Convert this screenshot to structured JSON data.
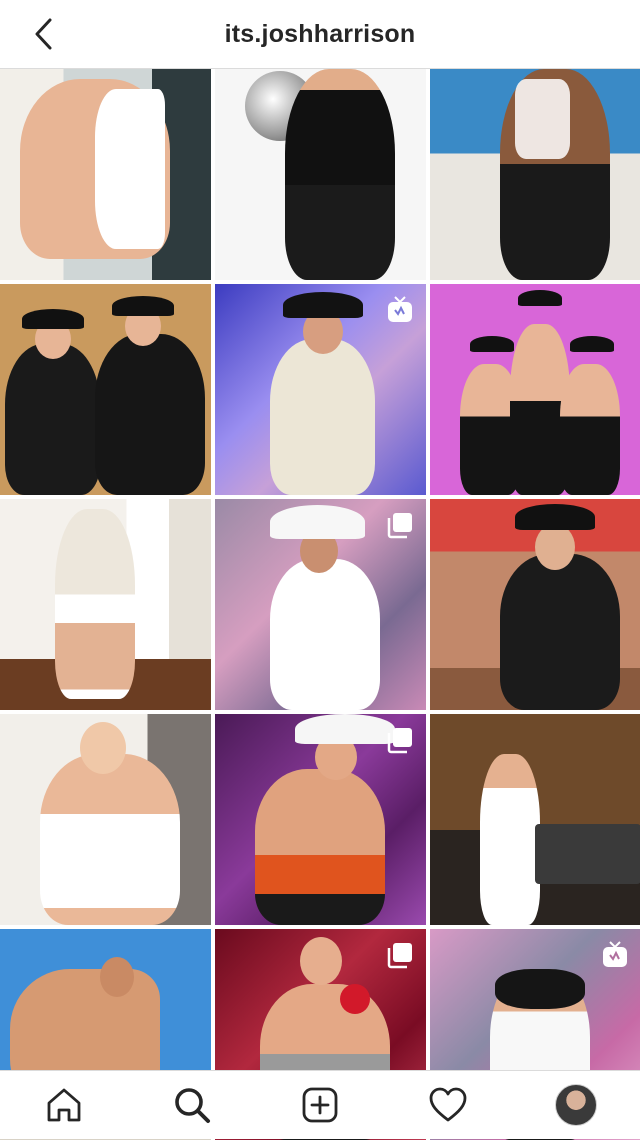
{
  "header": {
    "title": "its.joshharrison",
    "back_icon": "chevron-left-icon"
  },
  "grid": {
    "tiles": [
      {
        "name": "post-1",
        "badge": null
      },
      {
        "name": "post-2",
        "badge": null
      },
      {
        "name": "post-3",
        "badge": null
      },
      {
        "name": "post-4",
        "badge": null
      },
      {
        "name": "post-5",
        "badge": "igtv-icon"
      },
      {
        "name": "post-6",
        "badge": null
      },
      {
        "name": "post-7",
        "badge": null
      },
      {
        "name": "post-8",
        "badge": "carousel-icon"
      },
      {
        "name": "post-9",
        "badge": null
      },
      {
        "name": "post-10",
        "badge": null
      },
      {
        "name": "post-11",
        "badge": "carousel-icon"
      },
      {
        "name": "post-12",
        "badge": null
      },
      {
        "name": "post-13",
        "badge": null
      },
      {
        "name": "post-14",
        "badge": "carousel-icon"
      },
      {
        "name": "post-15",
        "badge": "igtv-icon"
      }
    ]
  },
  "bottom_nav": {
    "items": [
      "home-icon",
      "search-icon",
      "add-post-icon",
      "activity-heart-icon",
      "profile-avatar"
    ]
  },
  "colors": {
    "text": "#262626",
    "border": "#dbdbdb",
    "background": "#ffffff"
  }
}
